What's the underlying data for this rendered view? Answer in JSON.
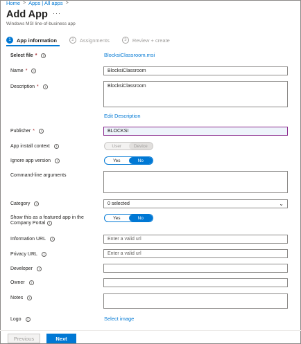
{
  "breadcrumb": [
    "Home",
    "Apps | All apps"
  ],
  "page": {
    "title": "Add App",
    "more": "···",
    "subtitle": "Windows MSI line-of-business app"
  },
  "steps": [
    {
      "num": "1",
      "label": "App information",
      "state": "active"
    },
    {
      "num": "2",
      "label": "Assignments",
      "state": "inactive"
    },
    {
      "num": "3",
      "label": "Review + create",
      "state": "inactive"
    }
  ],
  "form": {
    "select_file": {
      "label": "Select file",
      "value": "BlocksiClassroom.msi"
    },
    "name": {
      "label": "Name",
      "value": "BlocksiClassroom"
    },
    "description": {
      "label": "Description",
      "value": "BlocksiClassroom",
      "edit_link": "Edit Description"
    },
    "publisher": {
      "label": "Publisher",
      "value": "BLOCKSI"
    },
    "install_context": {
      "label": "App install context",
      "options": [
        "User",
        "Device"
      ],
      "selected": "Device"
    },
    "ignore_version": {
      "label": "Ignore app version",
      "options": [
        "Yes",
        "No"
      ],
      "selected": "No"
    },
    "command_line": {
      "label": "Command-line arguments",
      "value": ""
    },
    "category": {
      "label": "Category",
      "value": "0 selected"
    },
    "featured": {
      "label_line1": "Show this as a featured app in the",
      "label_line2": "Company Portal",
      "options": [
        "Yes",
        "No"
      ],
      "selected": "No"
    },
    "info_url": {
      "label": "Information URL",
      "placeholder": "Enter a valid url"
    },
    "privacy_url": {
      "label": "Privacy URL",
      "placeholder": "Enter a valid url"
    },
    "developer": {
      "label": "Developer",
      "value": ""
    },
    "owner": {
      "label": "Owner",
      "value": ""
    },
    "notes": {
      "label": "Notes",
      "value": ""
    },
    "logo": {
      "label": "Logo",
      "link": "Select image"
    }
  },
  "footer": {
    "previous": "Previous",
    "next": "Next"
  },
  "icons": {
    "info": "i",
    "chevron": "⌄",
    "breadcrumb_sep": ">"
  }
}
